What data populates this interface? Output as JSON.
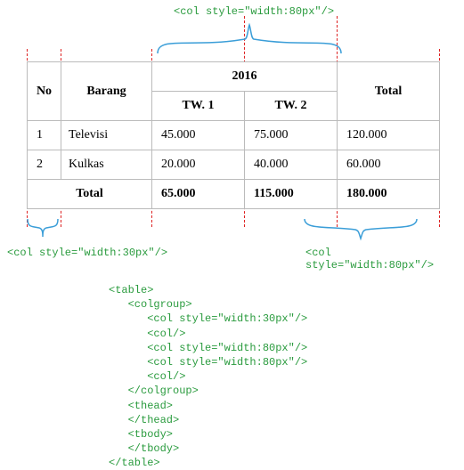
{
  "annotations": {
    "top": "<col style=\"width:80px\"/>",
    "bottom_left": "<col style=\"width:30px\"/>",
    "bottom_right": "<col style=\"width:80px\"/>"
  },
  "table": {
    "headers": {
      "no": "No",
      "barang": "Barang",
      "year": "2016",
      "tw1": "TW. 1",
      "tw2": "TW. 2",
      "total": "Total"
    },
    "rows": [
      {
        "no": "1",
        "barang": "Televisi",
        "tw1": "45.000",
        "tw2": "75.000",
        "total": "120.000"
      },
      {
        "no": "2",
        "barang": "Kulkas",
        "tw1": "20.000",
        "tw2": "40.000",
        "total": "60.000"
      }
    ],
    "total_row": {
      "label": "Total",
      "tw1": "65.000",
      "tw2": "115.000",
      "total": "180.000"
    }
  },
  "chart_data": {
    "type": "table",
    "title": "2016",
    "columns": [
      "No",
      "Barang",
      "TW. 1",
      "TW. 2",
      "Total"
    ],
    "rows": [
      [
        "1",
        "Televisi",
        45000,
        75000,
        120000
      ],
      [
        "2",
        "Kulkas",
        20000,
        40000,
        60000
      ]
    ],
    "totals": {
      "TW. 1": 65000,
      "TW. 2": 115000,
      "Total": 180000
    }
  },
  "code_block": "<table>\n   <colgroup>\n      <col style=\"width:30px\"/>\n      <col/>\n      <col style=\"width:80px\"/>\n      <col style=\"width:80px\"/>\n      <col/>\n   </colgroup>\n   <thead>\n   </thead>\n   <tbody>\n   </tbody>\n</table>"
}
